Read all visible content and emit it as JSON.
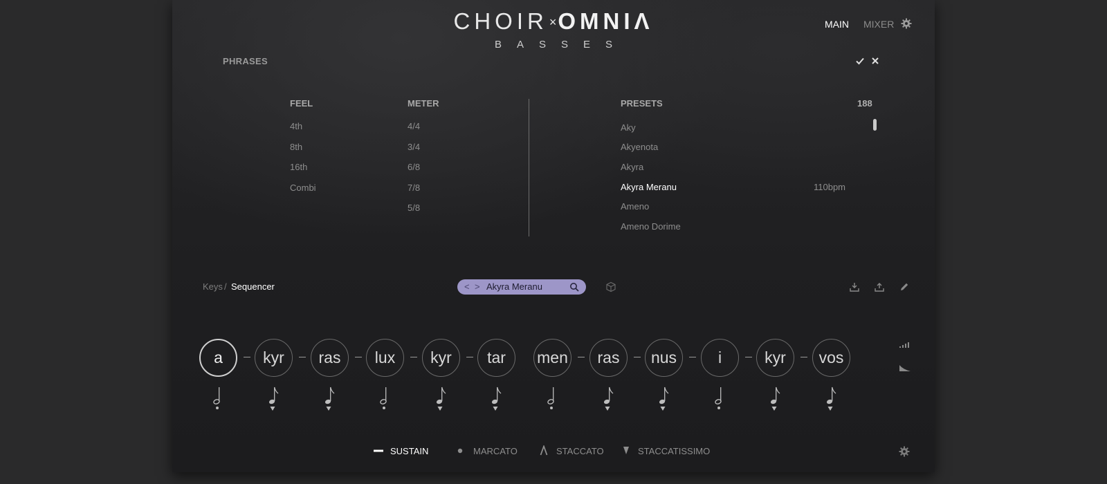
{
  "header": {
    "logo_left": "CHOIR",
    "logo_x": "×",
    "logo_right": "OMNIΛ",
    "subtitle": "BASSES",
    "nav": [
      {
        "label": "MAIN",
        "active": true
      },
      {
        "label": "MIXER",
        "active": false
      }
    ]
  },
  "phrases": {
    "title": "PHRASES",
    "feel": {
      "heading": "FEEL",
      "items": [
        "4th",
        "8th",
        "16th",
        "Combi"
      ]
    },
    "meter": {
      "heading": "METER",
      "items": [
        "4/4",
        "3/4",
        "6/8",
        "7/8",
        "5/8"
      ]
    },
    "presets": {
      "heading": "PRESETS",
      "count": "188",
      "items": [
        "Aky",
        "Akyenota",
        "Akyra",
        "Akyra Meranu",
        "Ameno",
        "Ameno Dorime"
      ],
      "selected_index": 3,
      "selected_bpm": "110bpm"
    }
  },
  "toolbar": {
    "mode_keys": "Keys",
    "mode_sep": "/",
    "mode_sequencer": "Sequencer",
    "preset_prev": "<",
    "preset_next": ">",
    "preset_name": "Akyra Meranu",
    "accent_color": "#9d96c8"
  },
  "sequence": {
    "syllables": [
      "a",
      "kyr",
      "ras",
      "lux",
      "kyr",
      "tar",
      "men",
      "ras",
      "nus",
      "i",
      "kyr",
      "vos"
    ],
    "dash": "–",
    "active_index": 0,
    "notes": [
      "half-sustain",
      "eighth-staccatissimo",
      "eighth-staccatissimo",
      "half-sustain",
      "eighth-staccatissimo",
      "eighth-staccatissimo",
      "half-sustain",
      "eighth-staccatissimo",
      "eighth-staccatissimo",
      "half-sustain",
      "eighth-staccatissimo",
      "eighth-staccatissimo"
    ]
  },
  "articulations": [
    {
      "label": "SUSTAIN",
      "icon": "dash-icon",
      "active": true
    },
    {
      "label": "MARCATO",
      "icon": "dot-icon",
      "active": false
    },
    {
      "label": "STACCATO",
      "icon": "caret-icon",
      "active": false
    },
    {
      "label": "STACCATISSIMO",
      "icon": "wedge-icon",
      "active": false
    }
  ]
}
